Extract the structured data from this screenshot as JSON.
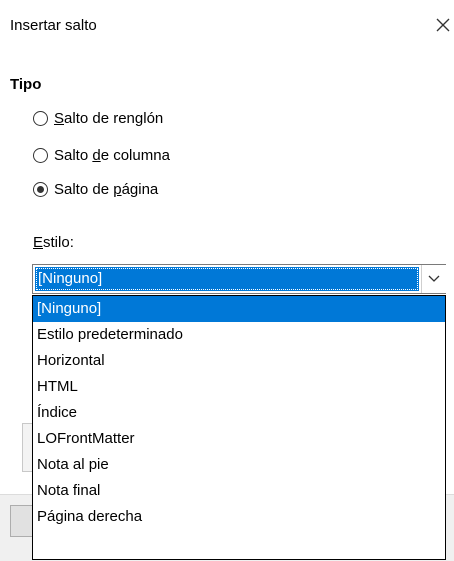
{
  "dialog": {
    "title": "Insertar salto",
    "close_icon": "close-icon"
  },
  "tipo": {
    "heading": "Tipo",
    "options": [
      {
        "pre": "",
        "accel": "S",
        "post": "alto de renglón",
        "selected": false
      },
      {
        "pre": "Salto ",
        "accel": "d",
        "post": "e columna",
        "selected": false
      },
      {
        "pre": "Salto de ",
        "accel": "p",
        "post": "ágina",
        "selected": true
      }
    ]
  },
  "estilo": {
    "label_accel": "E",
    "label_rest": "stilo:",
    "selected_value": "[Ninguno]",
    "arrow_icon": "chevron-down-icon",
    "options": [
      "[Ninguno]",
      "Estilo predeterminado",
      "Horizontal",
      "HTML",
      "Índice",
      "LOFrontMatter",
      "Nota al pie",
      "Nota final",
      "Página derecha"
    ],
    "highlighted_index": 0
  },
  "colors": {
    "accent": "#0078d7"
  }
}
